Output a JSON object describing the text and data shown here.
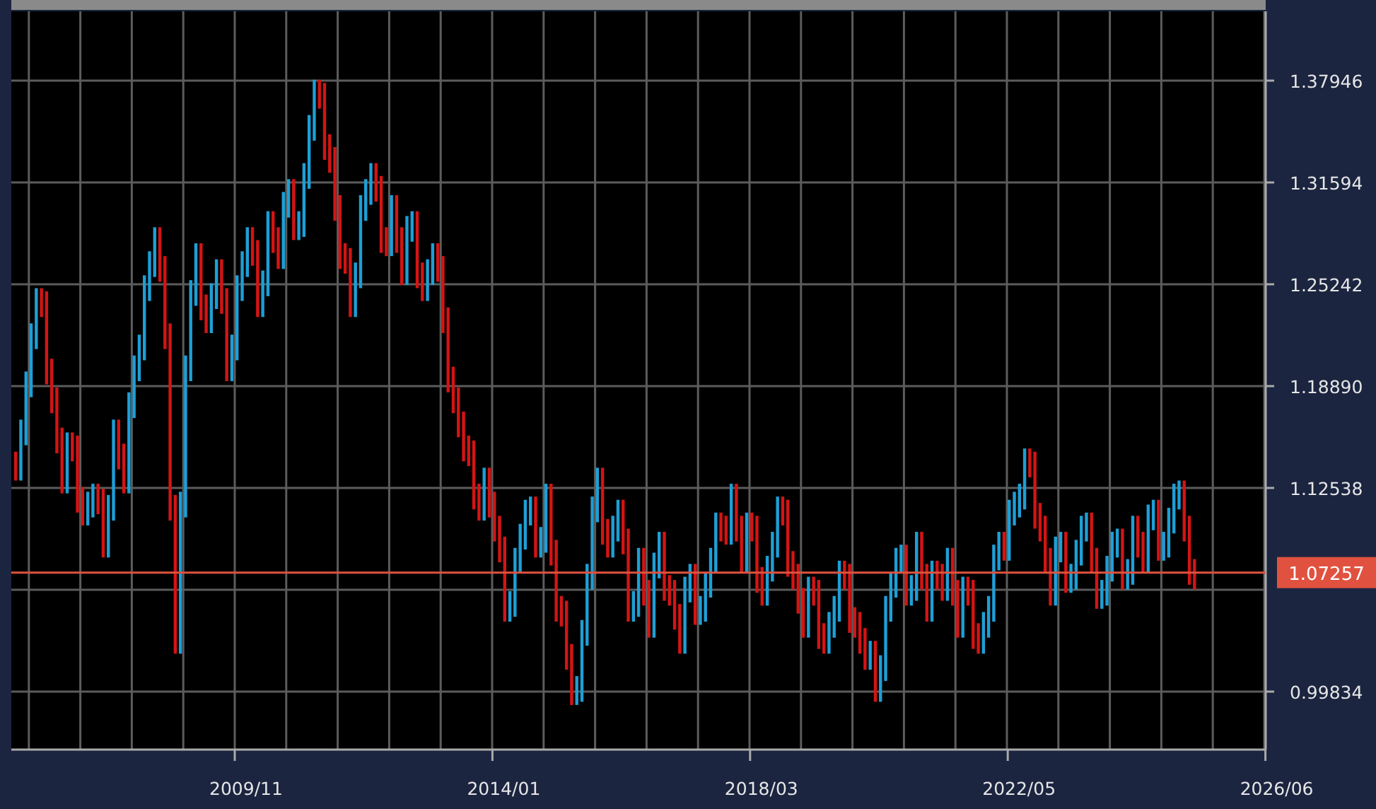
{
  "chart": {
    "y_axis_labels": [
      "1.37946",
      "1.31594",
      "1.25242",
      "1.18890",
      "1.12538",
      "0.99834"
    ],
    "x_axis_labels": [
      "2009/11",
      "2014/01",
      "2018/03",
      "2022/05",
      "2026/06"
    ],
    "price_label": "1.07257"
  }
}
